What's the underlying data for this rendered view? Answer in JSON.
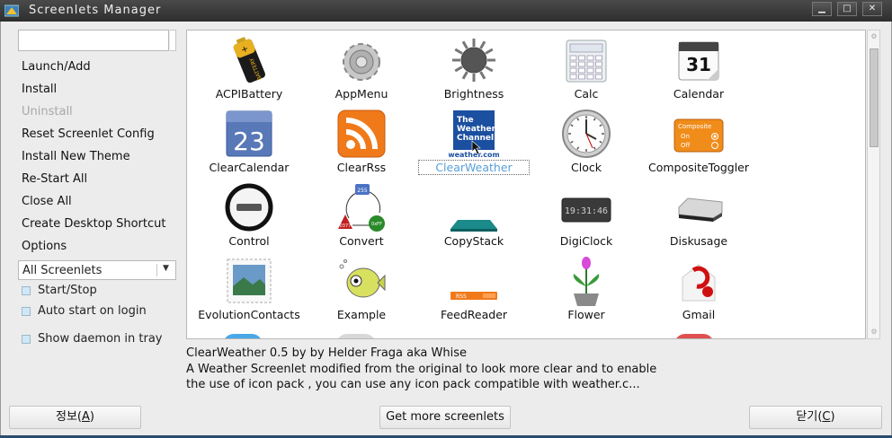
{
  "window": {
    "title": "Screenlets Manager",
    "minimize": "▁",
    "maximize": "□",
    "close": "✕"
  },
  "sidebar": {
    "search_value": "",
    "actions": [
      {
        "label": "Launch/Add",
        "enabled": true
      },
      {
        "label": "Install",
        "enabled": true
      },
      {
        "label": "Uninstall",
        "enabled": false
      },
      {
        "label": "Reset Screenlet Config",
        "enabled": true
      },
      {
        "label": "Install New Theme",
        "enabled": true
      },
      {
        "label": "Re-Start All",
        "enabled": true
      },
      {
        "label": "Close All",
        "enabled": true
      },
      {
        "label": "Create Desktop Shortcut",
        "enabled": true
      },
      {
        "label": "Options",
        "enabled": true
      }
    ],
    "filter": {
      "selected": "All Screenlets",
      "arrow": "▼"
    },
    "checks": [
      {
        "label": "Start/Stop",
        "checked": false
      },
      {
        "label": "Auto start on login",
        "checked": false
      },
      {
        "label": "Show daemon in tray",
        "checked": false
      }
    ]
  },
  "screenlets": [
    {
      "name": "ACPIBattery",
      "icon": "battery-icon"
    },
    {
      "name": "AppMenu",
      "icon": "app-menu-gear-icon"
    },
    {
      "name": "Brightness",
      "icon": "brightness-icon"
    },
    {
      "name": "Calc",
      "icon": "calculator-icon"
    },
    {
      "name": "Calendar",
      "icon": "calendar-icon",
      "text": "31"
    },
    {
      "name": "ClearCalendar",
      "icon": "clear-calendar-icon",
      "text": "23"
    },
    {
      "name": "ClearRss",
      "icon": "rss-icon"
    },
    {
      "name": "ClearWeather",
      "icon": "weather-channel-icon",
      "selected": true,
      "text_lines": [
        "The",
        "Weather",
        "Channel"
      ],
      "subtext": "weather.com"
    },
    {
      "name": "Clock",
      "icon": "clock-icon"
    },
    {
      "name": "CompositeToggler",
      "icon": "composite-toggler-icon",
      "text_lines": [
        "Composite",
        "On",
        "Off"
      ]
    },
    {
      "name": "Control",
      "icon": "control-icon"
    },
    {
      "name": "Convert",
      "icon": "convert-icon",
      "text_lines": [
        "255",
        "0377",
        "0xFF"
      ]
    },
    {
      "name": "CopyStack",
      "icon": "copystack-icon"
    },
    {
      "name": "DigiClock",
      "icon": "digital-clock-icon",
      "text": "19:31:46"
    },
    {
      "name": "Diskusage",
      "icon": "disk-usage-icon"
    },
    {
      "name": "EvolutionContacts",
      "icon": "contacts-stamp-icon"
    },
    {
      "name": "Example",
      "icon": "fish-example-icon"
    },
    {
      "name": "FeedReader",
      "icon": "feed-reader-icon",
      "text": "RSS"
    },
    {
      "name": "Flower",
      "icon": "flower-icon"
    },
    {
      "name": "Gmail",
      "icon": "gmail-icon"
    }
  ],
  "description": {
    "line1": "ClearWeather 0.5 by by Helder Fraga aka Whise",
    "line2": "A Weather Screenlet modified from the original to look more clear and to enable",
    "line3": "the use of icon pack , you can use any icon pack compatible with weather.c..."
  },
  "buttons": {
    "about_prefix": "정보(",
    "about_mnemonic": "A",
    "about_suffix": ")",
    "get_more": "Get more screenlets",
    "close_prefix": "닫기(",
    "close_mnemonic": "C",
    "close_suffix": ")"
  },
  "colors": {
    "selected_label": "#5aa0d8",
    "titlebar": "#3a3a3a",
    "rss_orange": "#f07a1a",
    "weather_blue": "#1b4fa0"
  }
}
